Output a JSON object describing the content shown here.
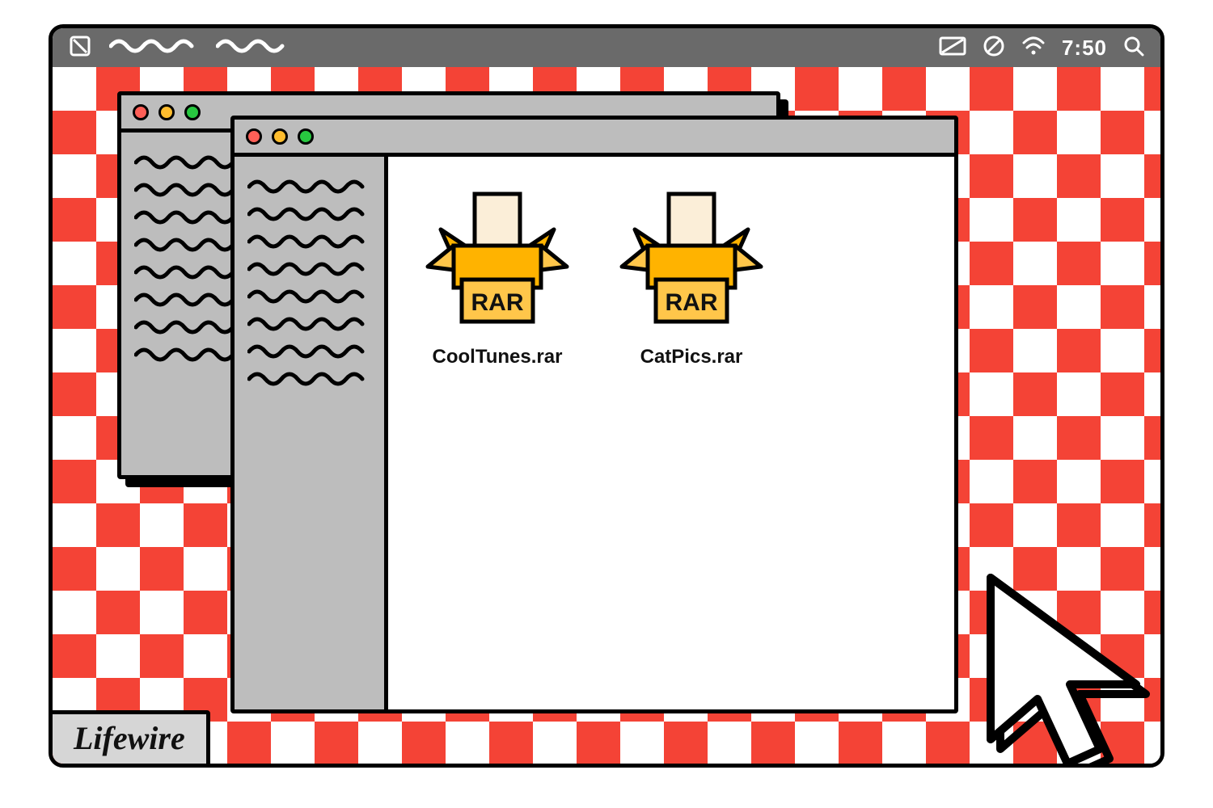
{
  "menubar": {
    "clock": "7:50"
  },
  "files": [
    {
      "name": "CoolTunes.rar",
      "icon_label": "RAR"
    },
    {
      "name": "CatPics.rar",
      "icon_label": "RAR"
    }
  ],
  "brand": "Lifewire",
  "colors": {
    "checker": "#f44336",
    "box_body": "#ffb300",
    "box_label": "#ffc64a",
    "paper": "#fbeed8"
  }
}
